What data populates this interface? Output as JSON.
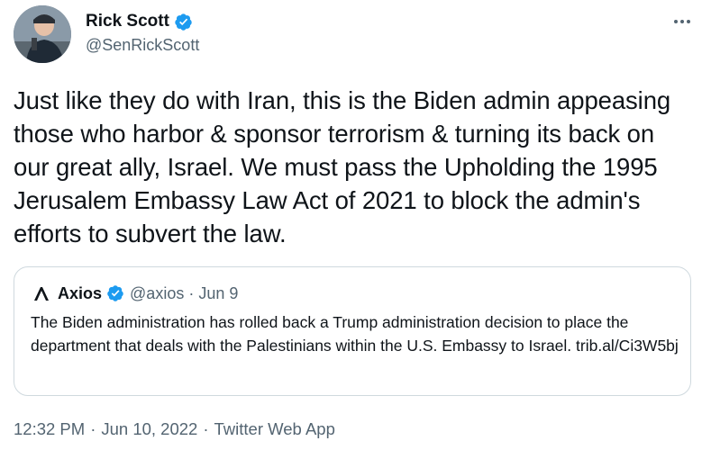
{
  "tweet": {
    "author_name": "Rick Scott",
    "author_handle": "@SenRickScott",
    "more_icon": "more-horizontal-icon",
    "text": "Just like they do with Iran, this is the Biden admin appeasing those who harbor & sponsor terrorism & turning its back on our great ally, Israel. We must pass the Upholding the 1995 Jerusalem Embassy Law Act of 2021 to block the admin's efforts to subvert the law.",
    "time": "12:32 PM",
    "date": "Jun 10, 2022",
    "source": "Twitter Web App",
    "separator": "·"
  },
  "quote": {
    "author_name": "Axios",
    "author_handle": "@axios",
    "separator": "·",
    "date": "Jun 9",
    "text": "The Biden administration has rolled back a Trump administration decision to place the department that deals with the Palestinians within the U.S. Embassy to Israel. trib.al/Ci3W5bj"
  },
  "colors": {
    "verified_blue": "#1d9bf0",
    "text_primary": "#0f1419",
    "text_secondary": "#536471",
    "border": "#cfd9de",
    "axios_logo": "#0f1419"
  }
}
